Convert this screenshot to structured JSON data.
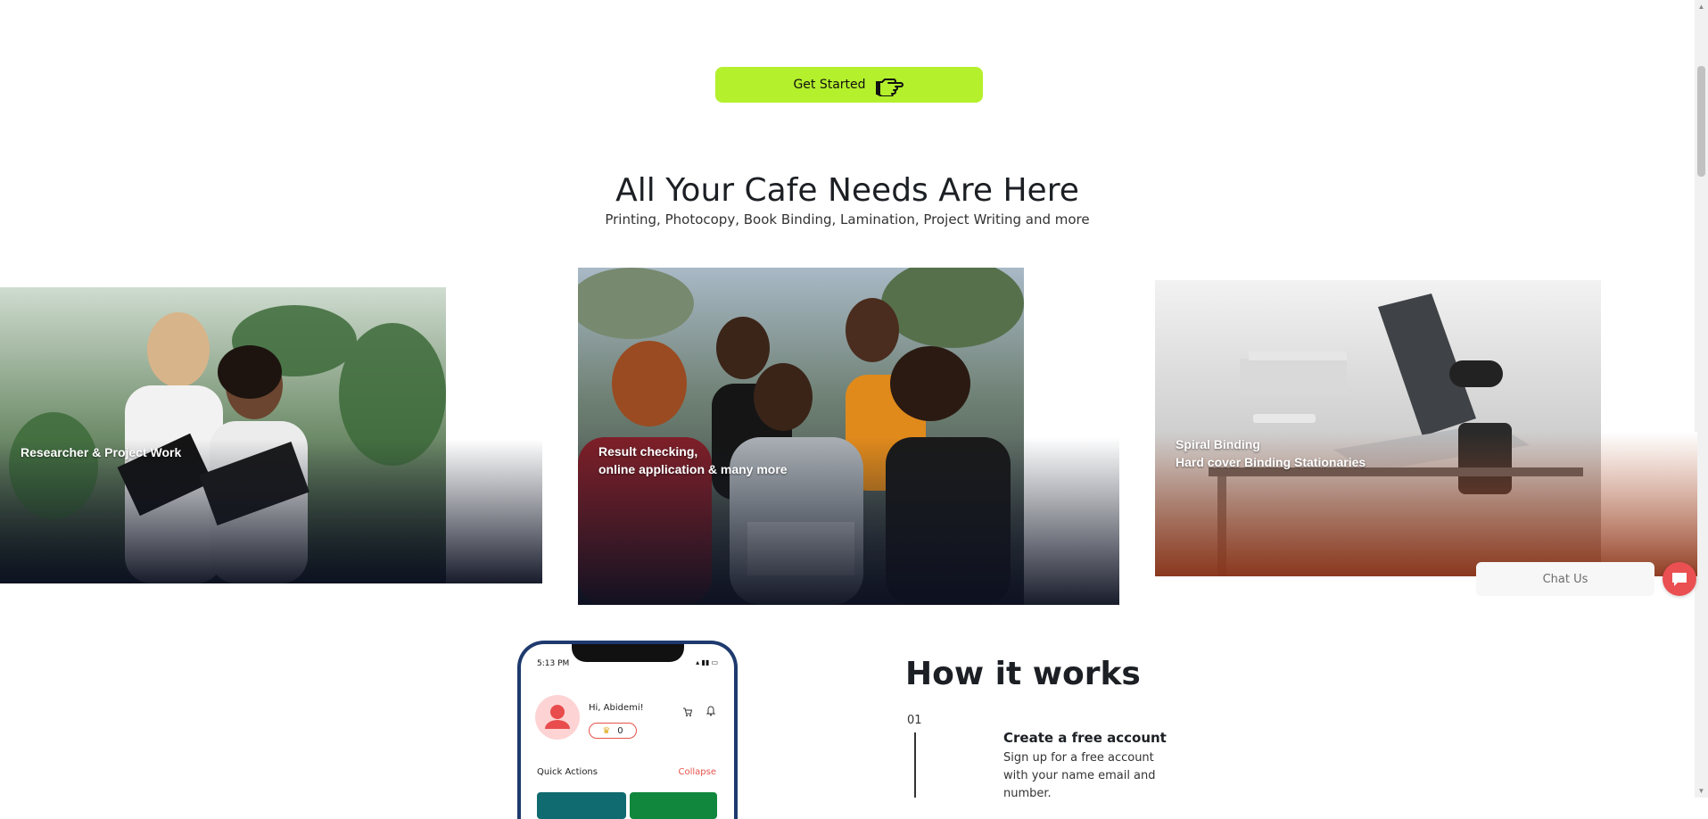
{
  "hero": {
    "cta_label": "Get Started"
  },
  "services": {
    "title": "All Your Cafe Needs Are Here",
    "subtitle": "Printing, Photocopy, Book Binding, Lamination, Project Writing and more",
    "cards": [
      {
        "caption_lines": [
          "Researcher & Project Work"
        ]
      },
      {
        "caption_lines": [
          "Result checking,",
          "online application & many more"
        ]
      },
      {
        "caption_lines": [
          "Spiral Binding",
          "Hard cover Binding Stationaries"
        ]
      }
    ]
  },
  "chat": {
    "label": "Chat Us",
    "accent": "#ea4f52"
  },
  "phone": {
    "time": "5:13 PM",
    "greeting": "Hi, Abidemi!",
    "coins": "0",
    "quick_actions": "Quick Actions",
    "collapse": "Collapse"
  },
  "how": {
    "title": "How it works",
    "steps": [
      {
        "num": "01",
        "title": "Create a free account",
        "desc": "Sign up for a free account with your name email and number."
      }
    ]
  },
  "colors": {
    "cta": "#b4f02c",
    "phone_frame": "#1e3a6e",
    "tile_teal": "#0f6b6f",
    "tile_green": "#11863d"
  }
}
